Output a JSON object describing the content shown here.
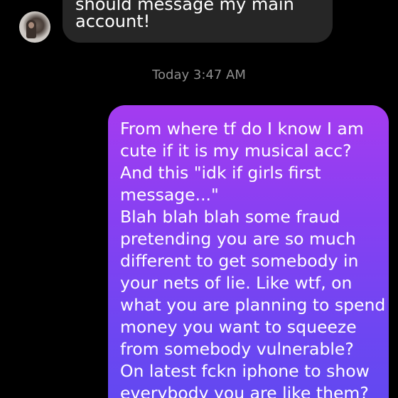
{
  "conversation": {
    "incoming": {
      "lines": [
        "should message my main",
        "account!"
      ]
    },
    "timestamp": "Today 3:47 AM",
    "outgoing": {
      "lines": [
        "From where tf do I know I am",
        "cute if it is my musical acc?",
        "And this \"idk if girls first",
        "message...\"",
        "Blah blah blah some fraud",
        "pretending you are so much",
        "different to get somebody in",
        "your nets of lie. Like wtf, on",
        "what you are planning to spend",
        "money you want to squeeze",
        "from somebody vulnerable?",
        "On latest fckn iphone to show",
        "everybody you are like them?"
      ]
    }
  },
  "colors": {
    "background": "#000000",
    "incoming_bubble": "#262626",
    "outgoing_gradient_top": "#a43cf0",
    "outgoing_gradient_bottom": "#5f49f0",
    "timestamp_text": "#8e8e8e"
  },
  "icons": {
    "avatar": "profile-photo"
  }
}
